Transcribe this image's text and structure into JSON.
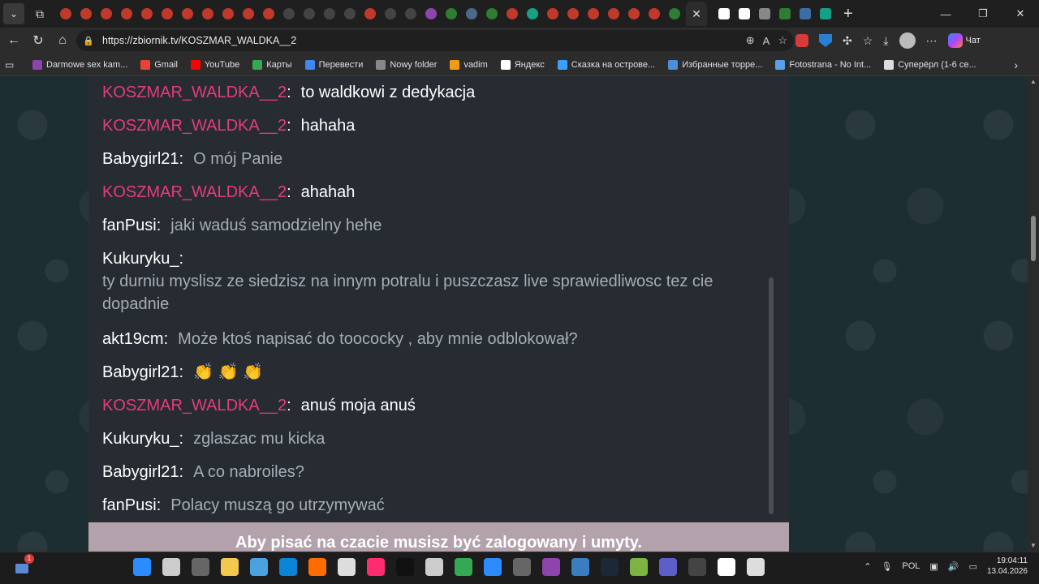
{
  "browser": {
    "url": "https://zbiornik.tv/KOSZMAR_WALDKA__2",
    "copilot_label": "Чат",
    "tab_favicon_colors": [
      "#c0392b",
      "#c0392b",
      "#c0392b",
      "#c0392b",
      "#c0392b",
      "#c0392b",
      "#c0392b",
      "#c0392b",
      "#c0392b",
      "#c0392b",
      "#c0392b",
      "#444",
      "#444",
      "#444",
      "#444",
      "#c0392b",
      "#444",
      "#444",
      "#8e44ad",
      "#2e7d32",
      "#4a6a8a",
      "#2e7d32",
      "#c0392b",
      "#16a085",
      "#c0392b",
      "#c0392b",
      "#c0392b",
      "#c0392b",
      "#c0392b",
      "#c0392b",
      "#2e7d32"
    ],
    "tab_after_active": [
      "#fff",
      "#fff",
      "#888",
      "#2e7d32",
      "#3a6ea5",
      "#16a085"
    ]
  },
  "bookmarks": [
    {
      "label": "Darmowe sex kam...",
      "color": "#8e44ad"
    },
    {
      "label": "Gmail",
      "color": "#ea4335"
    },
    {
      "label": "YouTube",
      "color": "#ff0000"
    },
    {
      "label": "Карты",
      "color": "#34a853"
    },
    {
      "label": "Перевести",
      "color": "#4285f4"
    },
    {
      "label": "Nowy folder",
      "color": "#888888"
    },
    {
      "label": "vadim",
      "color": "#f39c12"
    },
    {
      "label": "Яндекс",
      "color": "#ffffff"
    },
    {
      "label": "Сказка на острове...",
      "color": "#3aa0ff"
    },
    {
      "label": "Избранные торре...",
      "color": "#4a8fd8"
    },
    {
      "label": "Fotostrana - No Int...",
      "color": "#5aa0e8"
    },
    {
      "label": "Суперёрл (1-6 се...",
      "color": "#dddddd"
    }
  ],
  "chat": {
    "messages": [
      {
        "nick": "KOSZMAR_WALDKA__2",
        "host": true,
        "text": "to waldkowi z dedykacja"
      },
      {
        "nick": "KOSZMAR_WALDKA__2",
        "host": true,
        "text": "hahaha"
      },
      {
        "nick": "Babygirl21",
        "host": false,
        "text": "O mój Panie"
      },
      {
        "nick": "KOSZMAR_WALDKA__2",
        "host": true,
        "text": "ahahah"
      },
      {
        "nick": "fanPusi",
        "host": false,
        "text": "jaki waduś samodzielny hehe"
      },
      {
        "nick": "Kukuryku_",
        "host": false,
        "text": "ty durniu myslisz ze siedzisz na innym potralu i puszczasz live sprawiedliwosc tez cie dopadnie",
        "multiline": true
      },
      {
        "nick": "akt19cm",
        "host": false,
        "text": "Może ktoś napisać do toococky , aby mnie odblokował?"
      },
      {
        "nick": "Babygirl21",
        "host": false,
        "text": "👏 👏 👏"
      },
      {
        "nick": "KOSZMAR_WALDKA__2",
        "host": true,
        "text": "anuś moja anuś"
      },
      {
        "nick": "Kukuryku_",
        "host": false,
        "text": "zglaszac mu kicka"
      },
      {
        "nick": "Babygirl21",
        "host": false,
        "text": "A co nabroiles?"
      },
      {
        "nick": "fanPusi",
        "host": false,
        "text": "Polacy muszą go utrzymywać"
      }
    ],
    "login_notice": "Aby pisać na czacie musisz być zalogowany i umyty."
  },
  "taskbar": {
    "notification_count": "1",
    "language": "POL",
    "time": "19:04:11",
    "date": "13.04.2026",
    "app_colors": [
      "#2a8cff",
      "#cccccc",
      "#666666",
      "#f2c94c",
      "#4aa3df",
      "#0a84d6",
      "#ff6d00",
      "#dddddd",
      "#ff2d6f",
      "#111111",
      "#cccccc",
      "#34a853",
      "#2a8cff",
      "#666666",
      "#8e44ad",
      "#3a7ec0",
      "#1b2838",
      "#7cb342",
      "#5b5fc7",
      "#444444",
      "#ffffff",
      "#dddddd"
    ]
  }
}
